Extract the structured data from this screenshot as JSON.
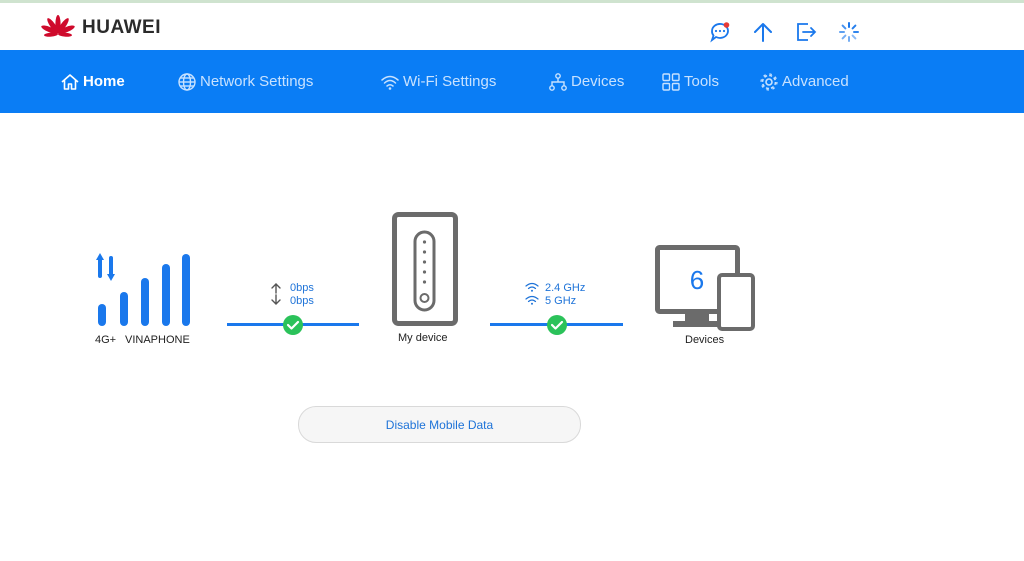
{
  "brand": {
    "name": "HUAWEI"
  },
  "header_icons": [
    "message-icon",
    "update-arrow-icon",
    "logout-icon",
    "loading-spinner-icon"
  ],
  "nav": {
    "items": [
      {
        "label": "Home",
        "icon": "home-icon",
        "active": true
      },
      {
        "label": "Network Settings",
        "icon": "globe-icon",
        "active": false
      },
      {
        "label": "Wi-Fi Settings",
        "icon": "wifi-icon",
        "active": false
      },
      {
        "label": "Devices",
        "icon": "devices-network-icon",
        "active": false
      },
      {
        "label": "Tools",
        "icon": "tools-grid-icon",
        "active": false
      },
      {
        "label": "Advanced",
        "icon": "gear-icon",
        "active": false
      }
    ]
  },
  "status": {
    "network_type": "4G+",
    "operator": "VINAPHONE",
    "upload_rate": "0bps",
    "download_rate": "0bps",
    "my_device_label": "My device",
    "wifi_band_1": "2.4 GHz",
    "wifi_band_2": "5 GHz",
    "devices_count": "6",
    "devices_label": "Devices"
  },
  "actions": {
    "disable_mobile_data": "Disable Mobile Data"
  },
  "colors": {
    "nav_bg": "#0a7df5",
    "accent_blue": "#1a78ec",
    "ok_green": "#2bc25a",
    "brand_red": "#cf0a2c",
    "device_gray": "#6b6b6b"
  }
}
